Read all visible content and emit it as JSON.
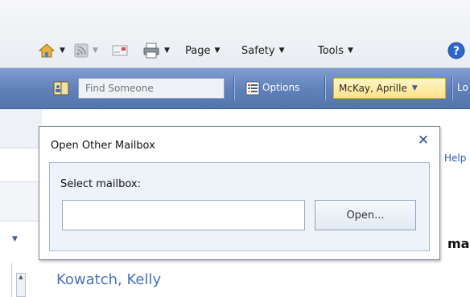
{
  "ie_command_bar": {
    "home_icon": "home-icon",
    "feeds_icon": "rss-feed-icon",
    "mail_icon": "mail-icon",
    "print_icon": "printer-icon",
    "help_icon": "help-icon",
    "menus": [
      {
        "label": "Page"
      },
      {
        "label": "Safety"
      },
      {
        "label": "Tools"
      }
    ]
  },
  "owa_toolbar": {
    "find_placeholder": "Find Someone",
    "options_label": "Options",
    "mailbox_user_label": "McKay, Aprille",
    "logoff_partial": "Lo"
  },
  "dialog": {
    "title": "Open Other Mailbox",
    "close_glyph": "✕",
    "select_label": "Select mailbox:",
    "mailbox_value": "",
    "open_button_label": "Open..."
  },
  "background_page": {
    "help_partial": "Help",
    "heading_partial": "ma",
    "contact_name": "Kowatch, Kelly"
  },
  "colors": {
    "toolbar_blue": "#5f80b8",
    "highlight_yellow": "#fde28a",
    "link_blue": "#4672c4",
    "dialog_panel": "#eef3fa"
  }
}
